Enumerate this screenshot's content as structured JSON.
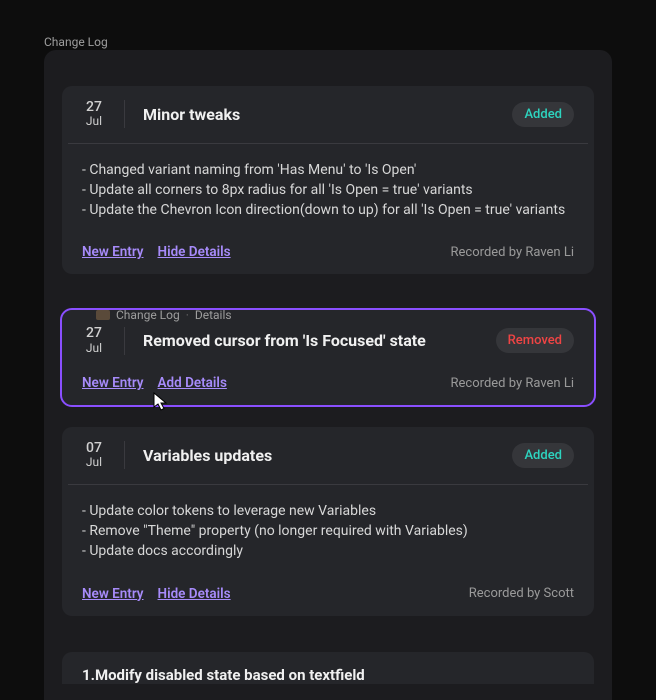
{
  "pageLabel": "Change Log",
  "breadcrumb": {
    "item1": "Change Log",
    "item2": "Details"
  },
  "entries": [
    {
      "day": "27",
      "month": "Jul",
      "title": "Minor tweaks",
      "badge": "Added",
      "badgeType": "added",
      "body": "- Changed variant naming from 'Has Menu' to 'Is Open'\n- Update all corners to 8px radius for all 'Is Open = true' variants\n- Update the Chevron Icon direction(down to up) for all 'Is Open = true' variants",
      "actions": {
        "newEntry": "New Entry",
        "toggle": "Hide Details"
      },
      "recordedBy": "Recorded by Raven Li"
    },
    {
      "day": "27",
      "month": "Jul",
      "title": "Removed cursor from 'Is Focused' state",
      "badge": "Removed",
      "badgeType": "removed",
      "actions": {
        "newEntry": "New Entry",
        "toggle": "Add Details"
      },
      "recordedBy": "Recorded by Raven Li"
    },
    {
      "day": "07",
      "month": "Jul",
      "title": "Variables updates",
      "badge": "Added",
      "badgeType": "added",
      "body": "- Update color tokens to leverage new Variables\n- Remove \"Theme\" property (no longer required with Variables)\n- Update docs accordingly",
      "actions": {
        "newEntry": "New Entry",
        "toggle": "Hide Details"
      },
      "recordedBy": "Recorded by Scott"
    }
  ],
  "partial": {
    "title": "1.Modify disabled state based on textfield"
  }
}
